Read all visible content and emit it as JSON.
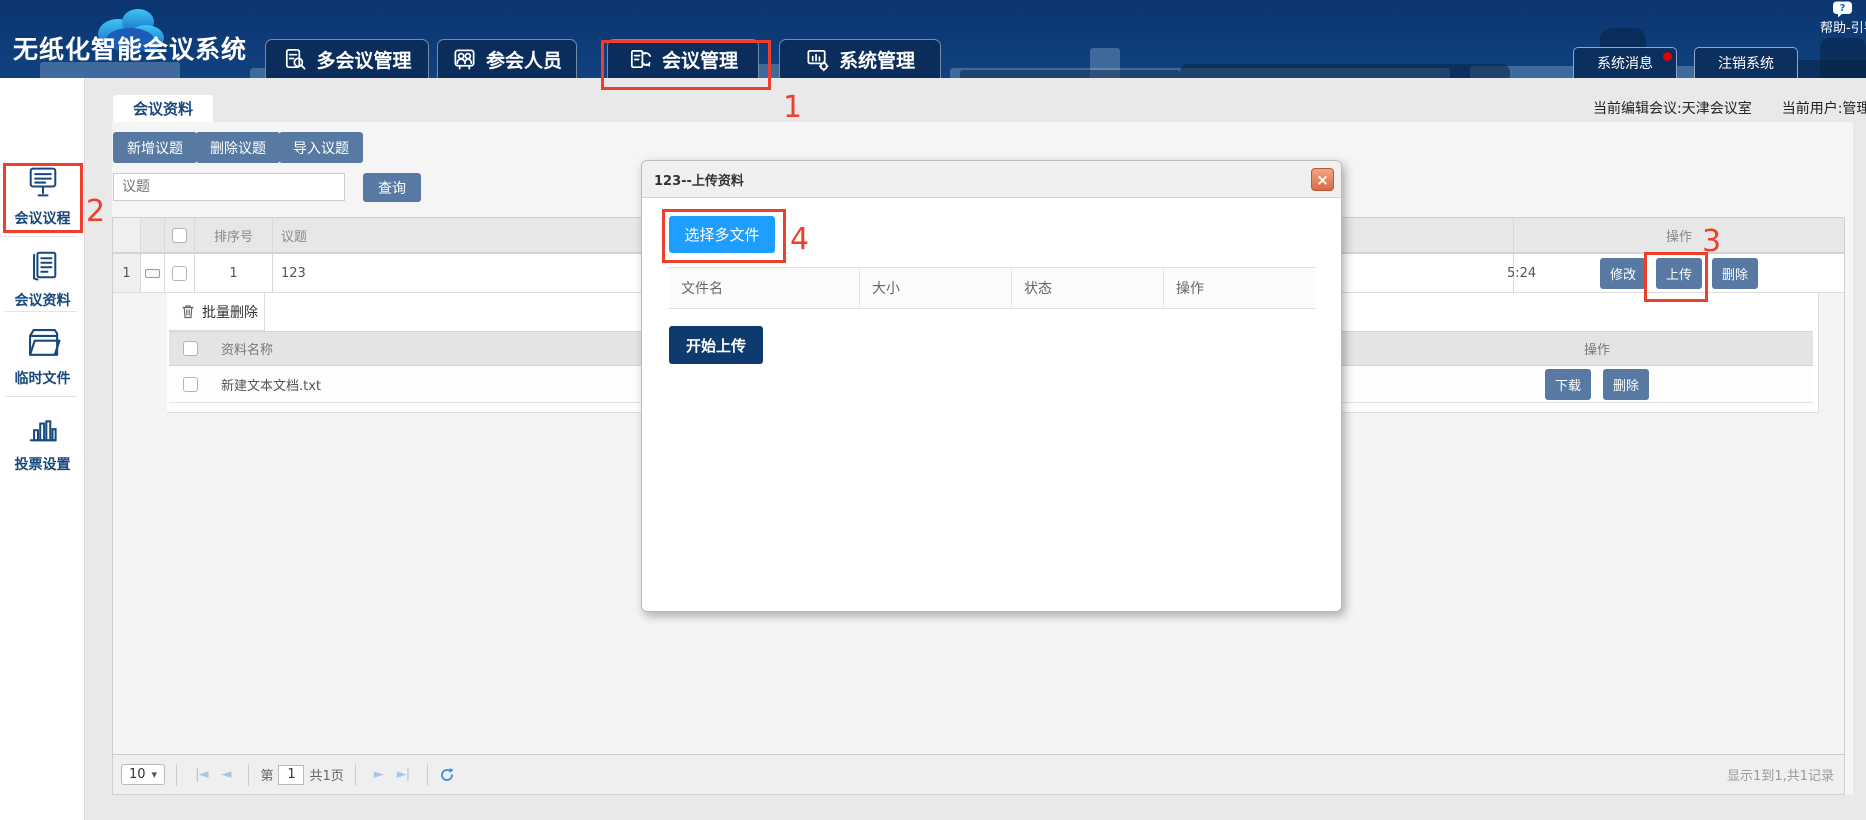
{
  "app": {
    "title": "无纸化智能会议系统",
    "help_label": "帮助-引导",
    "system_message_label": "系统消息",
    "logout_label": "注销系统",
    "current_meeting": "当前编辑会议:天津会议室",
    "current_user": "当前用户:管理员"
  },
  "nav": {
    "tabs": [
      {
        "label": "多会议管理"
      },
      {
        "label": "参会人员"
      },
      {
        "label": "会议管理"
      },
      {
        "label": "系统管理"
      }
    ]
  },
  "sidebar": {
    "items": [
      {
        "label": "会议议程"
      },
      {
        "label": "会议资料"
      },
      {
        "label": "临时文件"
      },
      {
        "label": "投票设置"
      }
    ]
  },
  "main": {
    "active_tab": "会议资料",
    "toolbar": {
      "add": "新增议题",
      "remove": "删除议题",
      "import": "导入议题"
    },
    "search": {
      "placeholder": "议题",
      "query": "查询"
    },
    "grid": {
      "header": {
        "order": "排序号",
        "topic": "议题",
        "actions": "操作"
      },
      "row": {
        "index": "1",
        "order": "1",
        "topic": "123",
        "time_fragment": "5:24",
        "edit": "修改",
        "upload": "上传",
        "delete": "删除"
      },
      "subgrid": {
        "batch_delete": "批量删除",
        "header": {
          "name": "资料名称",
          "actions": "操作"
        },
        "row": {
          "name": "新建文本文档.txt",
          "download": "下载",
          "delete": "删除"
        }
      }
    },
    "pager": {
      "page_size": "10",
      "label_page": "第",
      "page": "1",
      "label_total": "共1页",
      "summary": "显示1到1,共1记录"
    }
  },
  "modal": {
    "title": "123--上传资料",
    "close": "×",
    "select_files": "选择多文件",
    "columns": [
      "文件名",
      "大小",
      "状态",
      "操作"
    ],
    "start_upload": "开始上传"
  },
  "annotations": {
    "n1": "1",
    "n2": "2",
    "n3": "3",
    "n4": "4"
  },
  "icons": {
    "select_caret": "▾",
    "first": "|◄",
    "prev": "◄",
    "next": "►",
    "last": "►|"
  },
  "colors": {
    "topbar": "#0d3a75",
    "nav_tab": "#0a2d5c",
    "slate_button": "#587aa2",
    "primary_blue": "#1e9fff",
    "dark_navy_button": "#0e3a6d",
    "annotation_red": "#ee3f2c",
    "badge_red": "#e60000",
    "sidebar_icon": "#17497f"
  }
}
